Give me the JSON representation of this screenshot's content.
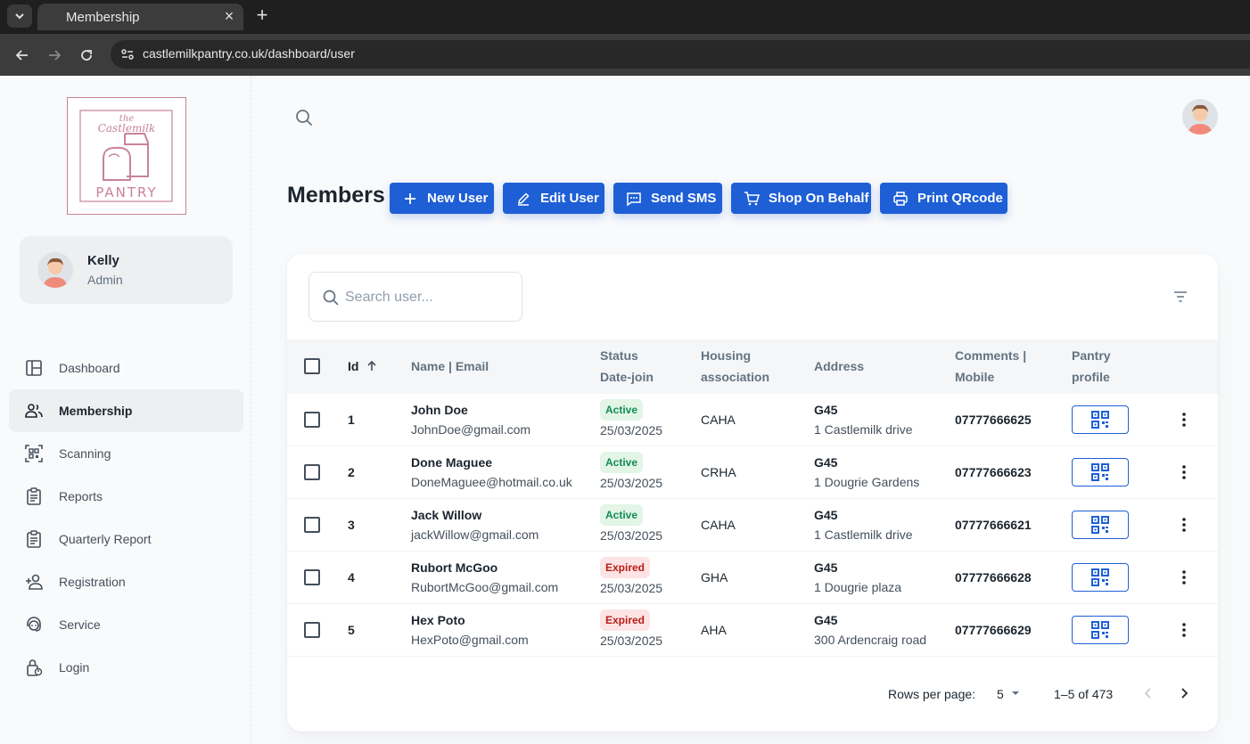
{
  "browser": {
    "tab_title": "Membership",
    "url": "castlemilkpantry.co.uk/dashboard/user"
  },
  "logo": {
    "line1": "the",
    "line2": "Castlemilk",
    "word": "PANTRY"
  },
  "user": {
    "name": "Kelly",
    "role": "Admin"
  },
  "nav": [
    {
      "label": "Dashboard",
      "icon": "dashboard-icon"
    },
    {
      "label": "Membership",
      "icon": "people-icon",
      "active": true
    },
    {
      "label": "Scanning",
      "icon": "qr-scan-icon"
    },
    {
      "label": "Reports",
      "icon": "clipboard-icon"
    },
    {
      "label": "Quarterly Report",
      "icon": "clipboard-icon"
    },
    {
      "label": "Registration",
      "icon": "add-person-icon"
    },
    {
      "label": "Service",
      "icon": "support-agent-icon"
    },
    {
      "label": "Login",
      "icon": "lock-person-icon"
    }
  ],
  "page": {
    "title": "Members"
  },
  "actions": {
    "new_user": "New User",
    "edit_user": "Edit User",
    "send_sms": "Send SMS",
    "shop_on_behalf": "Shop On Behalf",
    "print_qrcode": "Print QRcode"
  },
  "search": {
    "placeholder": "Search user..."
  },
  "table": {
    "headers": {
      "id": "Id",
      "name_email": "Name | Email",
      "status_1": "Status",
      "status_2": "Date-join",
      "housing_1": "Housing",
      "housing_2": "association",
      "address": "Address",
      "comments_1": "Comments |",
      "comments_2": "Mobile",
      "pantry_1": "Pantry",
      "pantry_2": "profile"
    },
    "rows": [
      {
        "id": "1",
        "name": "John Doe",
        "email": "JohnDoe@gmail.com",
        "status": "Active",
        "date": "25/03/2025",
        "housing": "CAHA",
        "postcode": "G45",
        "street": "1 Castlemilk drive",
        "mobile": "07777666625"
      },
      {
        "id": "2",
        "name": "Done Maguee",
        "email": "DoneMaguee@hotmail.co.uk",
        "status": "Active",
        "date": "25/03/2025",
        "housing": "CRHA",
        "postcode": "G45",
        "street": "1 Dougrie Gardens",
        "mobile": "07777666623"
      },
      {
        "id": "3",
        "name": "Jack Willow",
        "email": "jackWillow@gmail.com",
        "status": "Active",
        "date": "25/03/2025",
        "housing": "CAHA",
        "postcode": "G45",
        "street": "1 Castlemilk drive",
        "mobile": "07777666621"
      },
      {
        "id": "4",
        "name": "Rubort McGoo",
        "email": "RubortMcGoo@gmail.com",
        "status": "Expired",
        "date": "25/03/2025",
        "housing": "GHA",
        "postcode": "G45",
        "street": "1 Dougrie plaza",
        "mobile": "07777666628"
      },
      {
        "id": "5",
        "name": "Hex Poto",
        "email": "HexPoto@gmail.com",
        "status": "Expired",
        "date": "25/03/2025",
        "housing": "AHA",
        "postcode": "G45",
        "street": "300 Ardencraig road",
        "mobile": "07777666629"
      }
    ]
  },
  "pagination": {
    "rows_per_page_label": "Rows per page:",
    "rows_per_page": "5",
    "range": "1–5 of 473"
  },
  "colors": {
    "primary": "#1e5fd6",
    "active_bg": "#e3f5e6",
    "active_text": "#118d57",
    "expired_bg": "#fde4e4",
    "expired_text": "#b71d18",
    "logo_pink": "#c9829a"
  }
}
